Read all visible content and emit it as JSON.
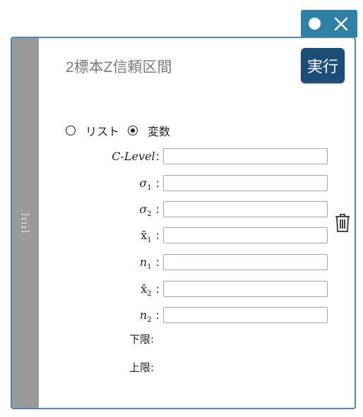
{
  "panel": {
    "title": "2標本Z信頼区間",
    "run_label": "実行"
  },
  "input_mode": {
    "options": [
      {
        "label": "リスト",
        "selected": false
      },
      {
        "label": "変数",
        "selected": true
      }
    ]
  },
  "fields": [
    {
      "name": "C-Level",
      "sub": "",
      "value": ""
    },
    {
      "name": "σ",
      "sub": "1",
      "value": ""
    },
    {
      "name": "σ",
      "sub": "2",
      "value": ""
    },
    {
      "name": "x̄",
      "sub": "1",
      "value": ""
    },
    {
      "name": "n",
      "sub": "1",
      "value": ""
    },
    {
      "name": "x̄",
      "sub": "2",
      "value": ""
    },
    {
      "name": "n",
      "sub": "2",
      "value": ""
    }
  ],
  "results": {
    "lower_label": "下限:",
    "upper_label": "上限:"
  },
  "colors": {
    "accent": "#2f81a6",
    "run_button": "#1f4d7a",
    "drag_bar": "#9a9a9a",
    "panel_border": "#4f87ad"
  },
  "icons": [
    "circle-icon",
    "close-icon",
    "drag-handle-icon",
    "trash-icon"
  ]
}
